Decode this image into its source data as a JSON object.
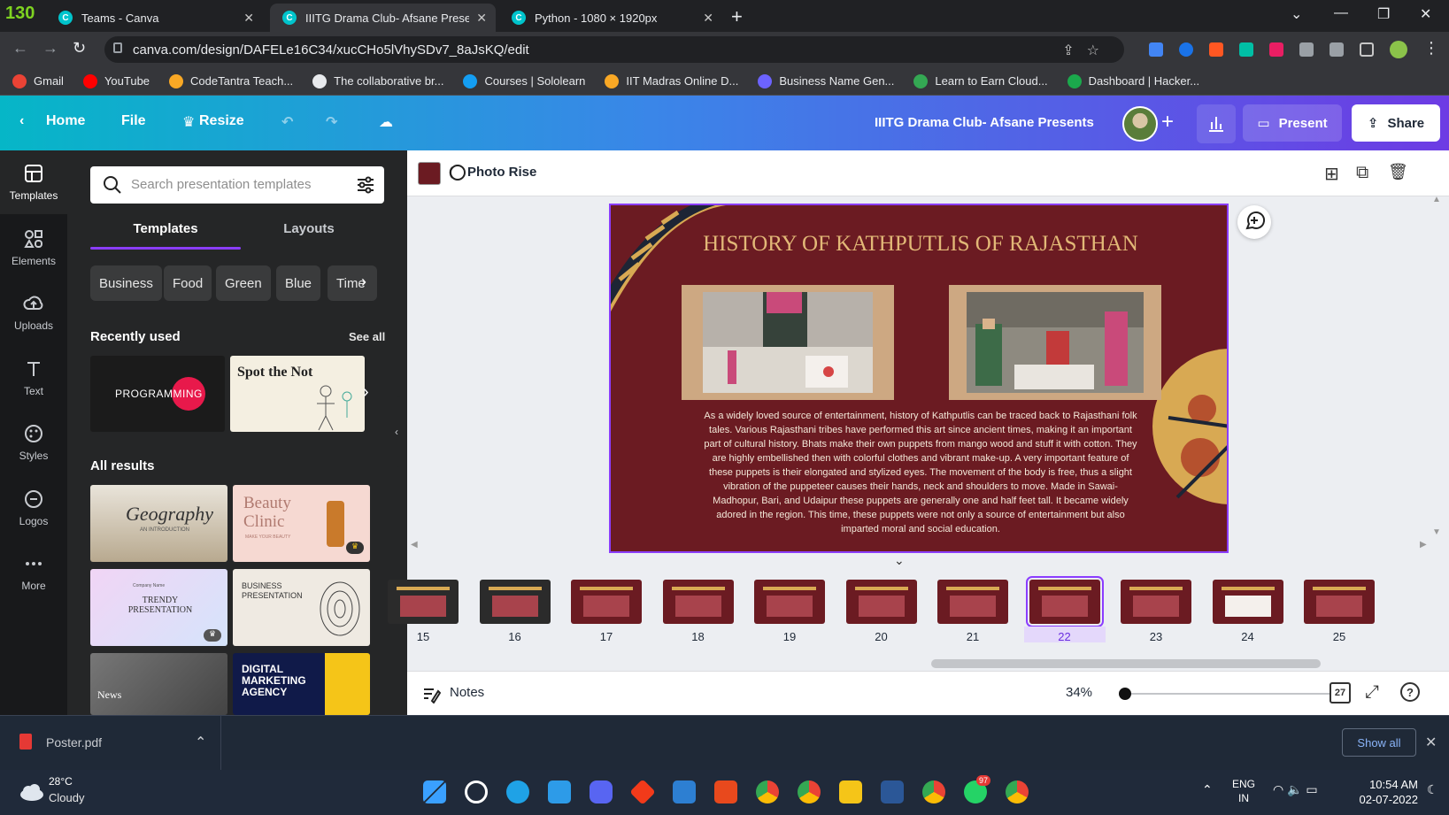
{
  "browser": {
    "tab_counter": "130",
    "tabs": [
      {
        "label": "Teams - Canva",
        "active": false
      },
      {
        "label": "IIITG Drama Club- Afsane Presents",
        "active": true
      },
      {
        "label": "Python - 1080 × 1920px",
        "active": false
      }
    ],
    "url": "canva.com/design/DAFELe16C34/xucCHo5lVhySDv7_8aJsKQ/edit",
    "bookmarks": [
      {
        "label": "Gmail",
        "color": "#ea4335"
      },
      {
        "label": "YouTube",
        "color": "#ff0000"
      },
      {
        "label": "CodeTantra Teach...",
        "color": "#f9a825"
      },
      {
        "label": "The collaborative br...",
        "color": "#e8eaed"
      },
      {
        "label": "Courses | Sololearn",
        "color": "#149ef2"
      },
      {
        "label": "IIT Madras Online D...",
        "color": "#f9a825"
      },
      {
        "label": "Business Name Gen...",
        "color": "#6c63ff"
      },
      {
        "label": "Learn to Earn Cloud...",
        "color": "#34a853"
      },
      {
        "label": "Dashboard | Hacker...",
        "color": "#1ba94c"
      }
    ]
  },
  "canva_header": {
    "home": "Home",
    "file": "File",
    "resize": "Resize",
    "title": "IIITG Drama Club- Afsane Presents",
    "present": "Present",
    "share": "Share"
  },
  "rail": [
    {
      "label": "Templates",
      "icon": "templates-icon",
      "active": true
    },
    {
      "label": "Elements",
      "icon": "elements-icon",
      "active": false
    },
    {
      "label": "Uploads",
      "icon": "uploads-icon",
      "active": false
    },
    {
      "label": "Text",
      "icon": "text-icon",
      "active": false
    },
    {
      "label": "Styles",
      "icon": "styles-icon",
      "active": false
    },
    {
      "label": "Logos",
      "icon": "logos-icon",
      "active": false
    },
    {
      "label": "More",
      "icon": "more-icon",
      "active": false
    }
  ],
  "panel": {
    "search_placeholder": "Search presentation templates",
    "tabs": [
      "Templates",
      "Layouts"
    ],
    "chips": [
      "Business",
      "Food",
      "Green",
      "Blue",
      "Time"
    ],
    "recently_used": "Recently used",
    "see_all": "See all",
    "recent_thumbs": [
      {
        "title": "PROGRAMMING"
      },
      {
        "title": "Spot the Not"
      }
    ],
    "all_results": "All results",
    "result_thumbs": [
      {
        "title": "Geography",
        "subtitle": "AN INTRODUCTION"
      },
      {
        "title": "Beauty Clinic",
        "subtitle": "MAKE YOUR BEAUTY"
      },
      {
        "title": "TRENDY PRESENTATION",
        "subtitle": "Company Name"
      },
      {
        "title": "BUSINESS PRESENTATION",
        "subtitle": ""
      },
      {
        "title": "News",
        "subtitle": ""
      },
      {
        "title": "DIGITAL MARKETING AGENCY",
        "subtitle": ""
      }
    ]
  },
  "toolbar": {
    "swatch_color": "#6b1b22",
    "animation": "Photo Rise"
  },
  "slide": {
    "title": "HISTORY OF KATHPUTLIS OF RAJASTHAN",
    "body": "As a widely loved source of entertainment,  history of Kathputlis can be traced back to Rajasthani folk tales. Various Rajasthani tribes have performed this art since ancient times, making it an important part of cultural history. Bhats make their own puppets from mango wood and stuff it with cotton. They are highly embellished then with colorful clothes and vibrant make-up. A very important feature of these puppets is their elongated and stylized eyes. The movement of the body is free, thus a slight vibration of the puppeteer causes their hands, neck and shoulders to move. Made in Sawai-Madhopur, Bari, and Udaipur these puppets are generally one and half feet tall. It became widely adored in the region. This time, these puppets were not only a source of entertainment but also imparted moral and social education."
  },
  "filmstrip": {
    "pages": [
      "15",
      "16",
      "17",
      "18",
      "19",
      "20",
      "21",
      "22",
      "23",
      "24",
      "25"
    ],
    "selected": "22"
  },
  "footer": {
    "notes": "Notes",
    "zoom": "34%",
    "page_count": "27"
  },
  "downloads": {
    "file": "Poster.pdf",
    "show_all": "Show all"
  },
  "taskbar": {
    "temp": "28°C",
    "condition": "Cloudy",
    "lang1": "ENG",
    "lang2": "IN",
    "time": "10:54 AM",
    "date": "02-07-2022",
    "whatsapp_badge": "97"
  }
}
